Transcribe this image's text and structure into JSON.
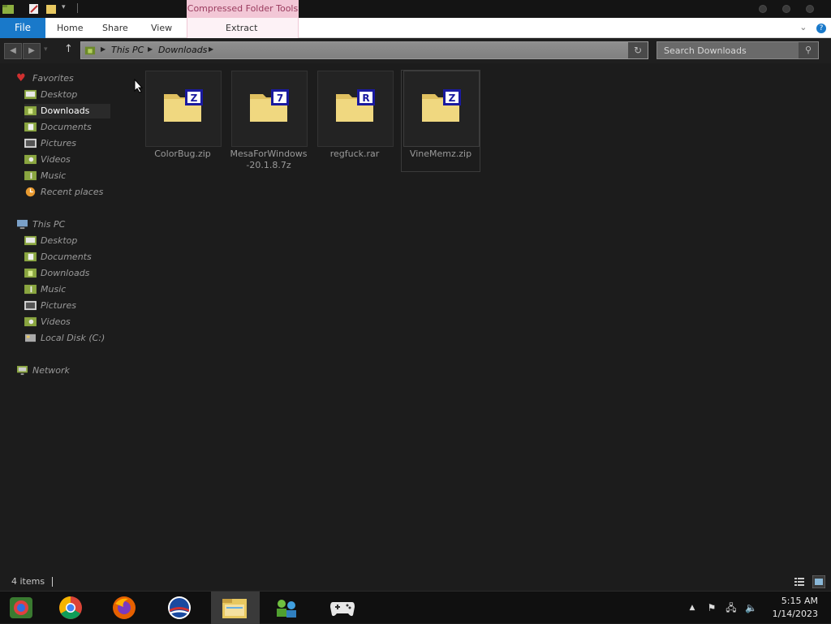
{
  "title_bar": {
    "contextual_tab": "Compressed Folder Tools"
  },
  "ribbon": {
    "tabs": [
      "File",
      "Home",
      "Share",
      "View",
      "Extract"
    ]
  },
  "address": {
    "crumbs": [
      "This PC",
      "Downloads"
    ],
    "search_placeholder": "Search Downloads"
  },
  "nav": {
    "favorites_header": "Favorites",
    "favorites": [
      "Desktop",
      "Downloads",
      "Documents",
      "Pictures",
      "Videos",
      "Music",
      "Recent places"
    ],
    "thispc_header": "This PC",
    "thispc": [
      "Desktop",
      "Documents",
      "Downloads",
      "Music",
      "Pictures",
      "Videos",
      "Local Disk (C:)"
    ],
    "network": "Network"
  },
  "files": [
    {
      "name": "ColorBug.zip",
      "badge": "Z"
    },
    {
      "name": "MesaForWindows-20.1.8.7z",
      "badge": "7"
    },
    {
      "name": "regfuck.rar",
      "badge": "R"
    },
    {
      "name": "VineMemz.zip",
      "badge": "Z"
    }
  ],
  "status": {
    "count": "4 items"
  },
  "taskbar": {
    "time": "5:15 AM",
    "date": "1/14/2023"
  },
  "colors": {
    "file_tab": "#1979ca",
    "context_tab": "#f2c7d6",
    "background": "#1c1c1c",
    "selected_nav": "#2a2a2a"
  }
}
